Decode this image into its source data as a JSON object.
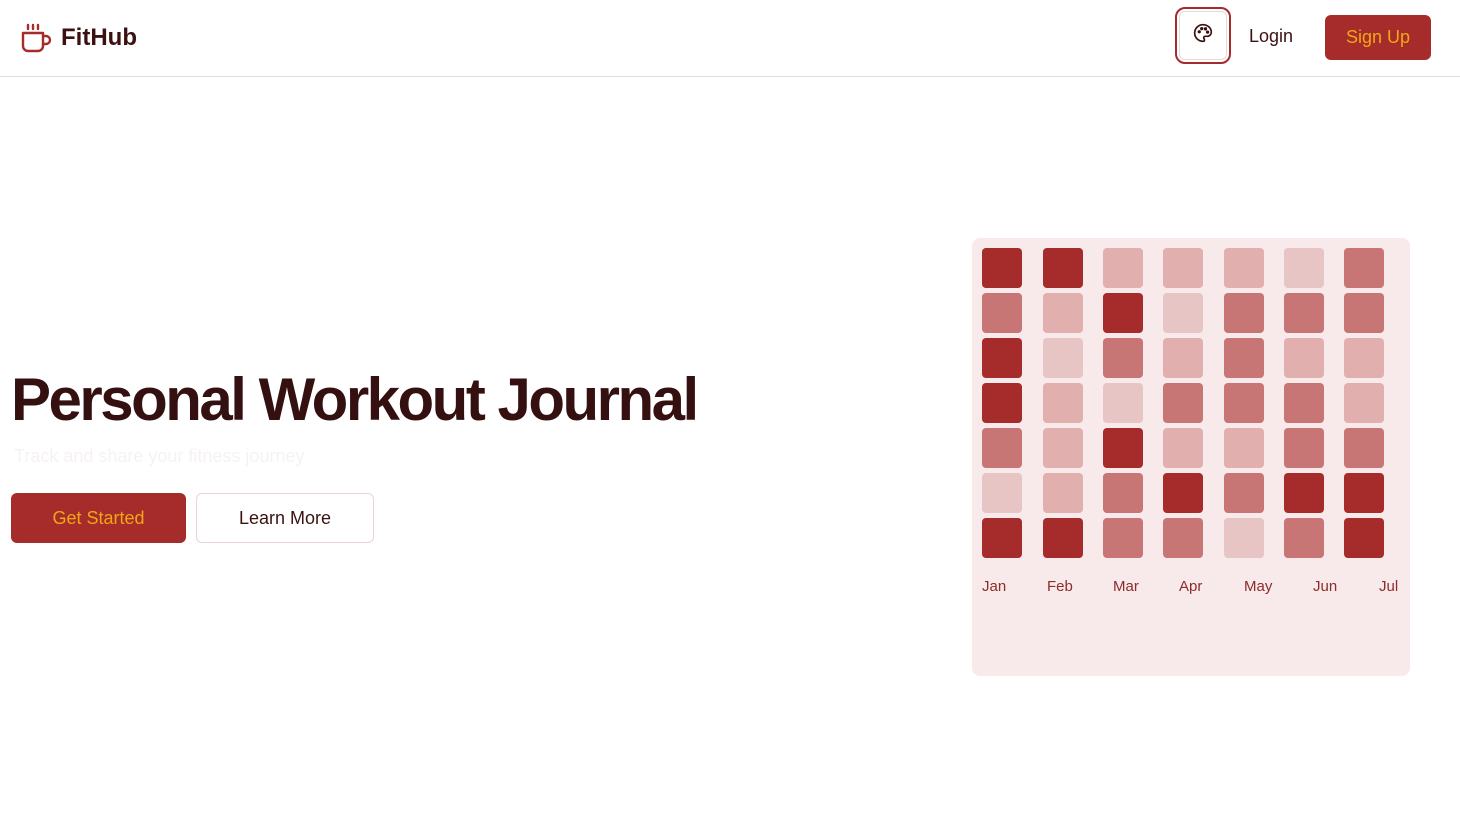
{
  "header": {
    "brand_name": "FitHub",
    "brand_icon": "coffee-cup-icon",
    "theme_icon": "palette-icon",
    "login_label": "Login",
    "signup_label": "Sign Up"
  },
  "hero": {
    "title": "Personal Workout Journal",
    "subtitle": "Track and share your fitness journey",
    "primary_button": "Get Started",
    "secondary_button": "Learn More"
  },
  "heatmap": {
    "months": [
      "Jan",
      "Feb",
      "Mar",
      "Apr",
      "May",
      "Jun",
      "Jul"
    ],
    "intensity_levels": 4,
    "columns": [
      [
        4,
        3,
        4,
        4,
        3,
        1,
        4
      ],
      [
        4,
        2,
        1,
        2,
        2,
        2,
        4
      ],
      [
        2,
        4,
        3,
        1,
        4,
        3,
        3
      ],
      [
        2,
        1,
        2,
        3,
        2,
        4,
        3
      ],
      [
        2,
        3,
        3,
        3,
        2,
        3,
        1
      ],
      [
        1,
        3,
        2,
        3,
        3,
        4,
        3
      ],
      [
        3,
        3,
        2,
        2,
        3,
        4,
        4
      ]
    ]
  },
  "colors": {
    "primary": "#a62b2b",
    "accent": "#f2a516",
    "text_dark": "#351010",
    "heatmap_bg": "#f8eaea",
    "level_1": "#e7c5c5",
    "level_2": "#e2afaf",
    "level_3": "#c87575",
    "level_4": "#a62b2b"
  }
}
